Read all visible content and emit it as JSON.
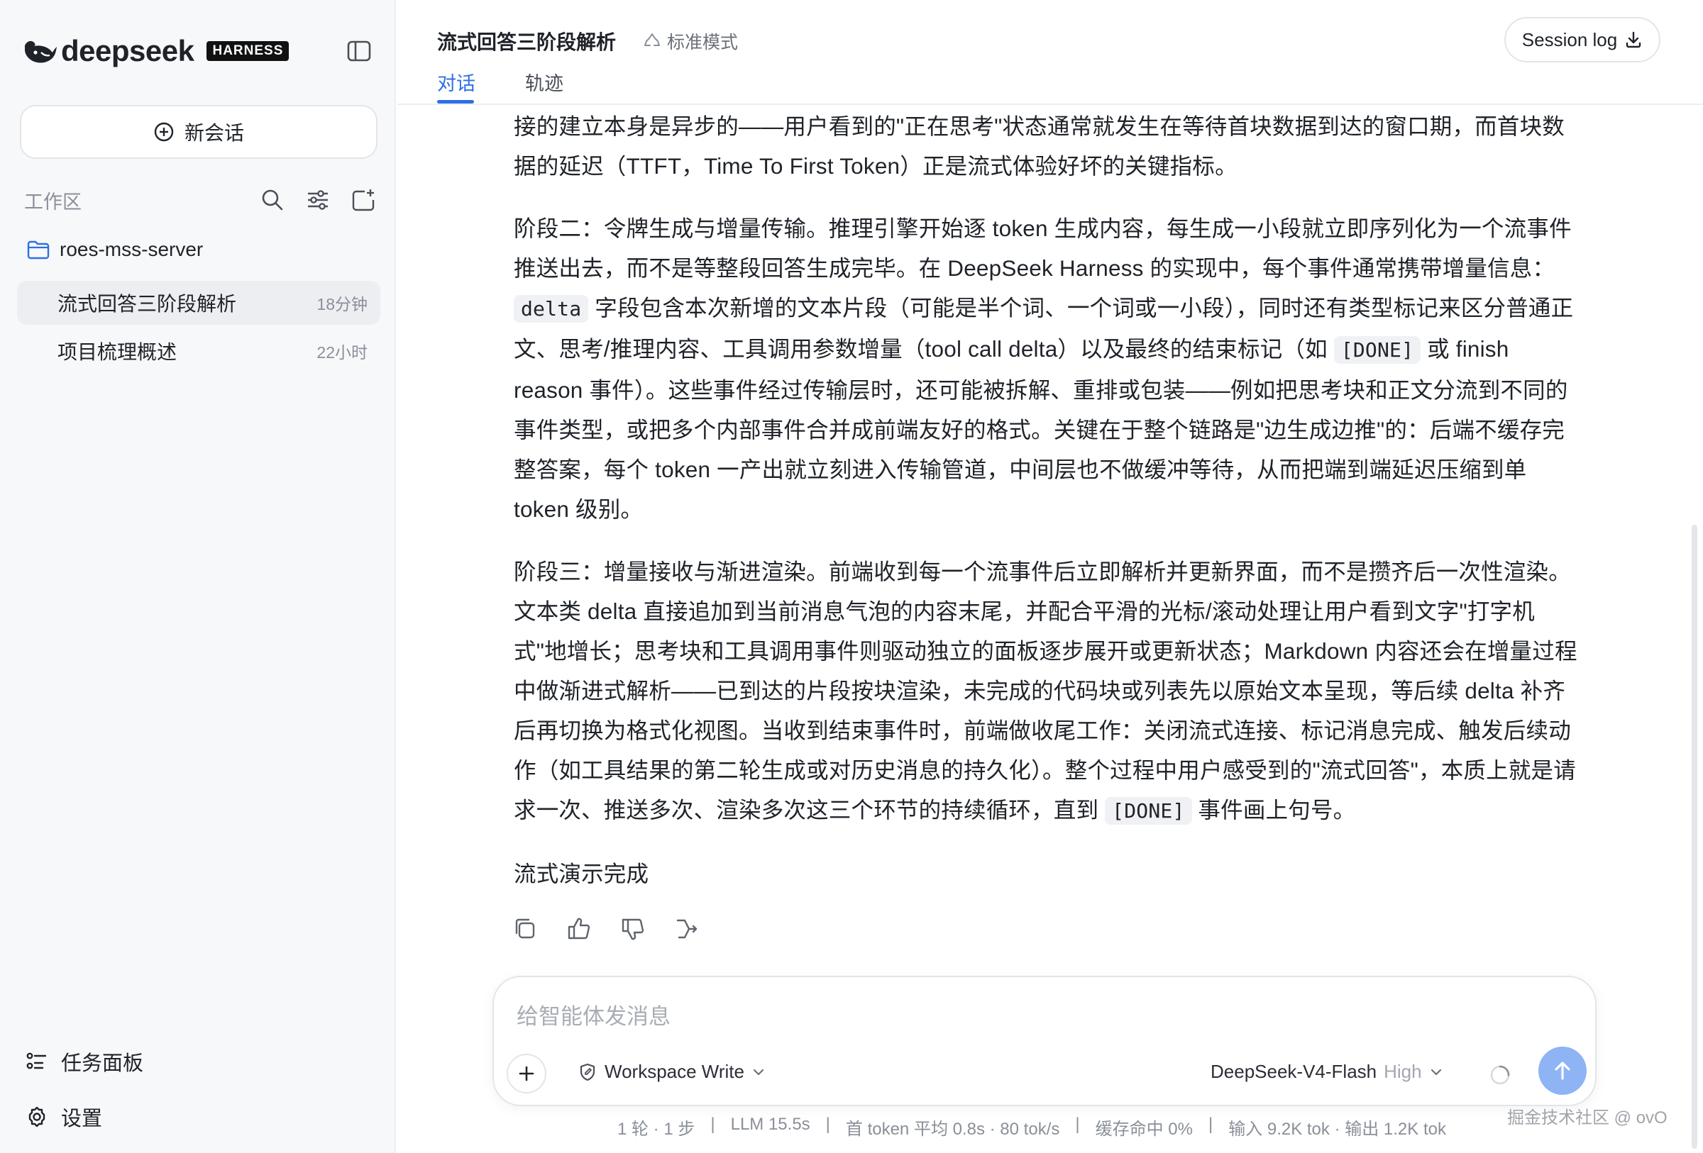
{
  "sidebar": {
    "brand_name": "deepseek",
    "brand_badge": "HARNESS",
    "new_chat_label": "新会话",
    "workspace_title": "工作区",
    "project_name": "roes-mss-server",
    "chats": [
      {
        "label": "流式回答三阶段解析",
        "time": "18分钟",
        "active": true
      },
      {
        "label": "项目梳理概述",
        "time": "22小时",
        "active": false
      }
    ],
    "task_board_label": "任务面板",
    "settings_label": "设置"
  },
  "header": {
    "title": "流式回答三阶段解析",
    "mode_label": "标准模式",
    "tabs": [
      {
        "label": "对话",
        "active": true
      },
      {
        "label": "轨迹",
        "active": false
      }
    ],
    "session_log_label": "Session log"
  },
  "message": {
    "p1": "接的建立本身是异步的——用户看到的\"正在思考\"状态通常就发生在等待首块数据到达的窗口期，而首块数据的延迟（TTFT，Time To First Token）正是流式体验好坏的关键指标。",
    "p2a": "阶段二：令牌生成与增量传输。推理引擎开始逐 token 生成内容，每生成一小段就立即序列化为一个流事件推送出去，而不是等整段回答生成完毕。在 DeepSeek Harness 的实现中，每个事件通常携带增量信息：",
    "p2_code1": "delta",
    "p2b": " 字段包含本次新增的文本片段（可能是半个词、一个词或一小段），同时还有类型标记来区分普通正文、思考/推理内容、工具调用参数增量（tool call delta）以及最终的结束标记（如 ",
    "p2_code2": "[DONE]",
    "p2c": " 或 finish reason 事件）。这些事件经过传输层时，还可能被拆解、重排或包装——例如把思考块和正文分流到不同的事件类型，或把多个内部事件合并成前端友好的格式。关键在于整个链路是\"边生成边推\"的：后端不缓存完整答案，每个 token 一产出就立刻进入传输管道，中间层也不做缓冲等待，从而把端到端延迟压缩到单 token 级别。",
    "p3a": "阶段三：增量接收与渐进渲染。前端收到每一个流事件后立即解析并更新界面，而不是攒齐后一次性渲染。文本类 delta 直接追加到当前消息气泡的内容末尾，并配合平滑的光标/滚动处理让用户看到文字\"打字机式\"地增长；思考块和工具调用事件则驱动独立的面板逐步展开或更新状态；Markdown 内容还会在增量过程中做渐进式解析——已到达的片段按块渲染，未完成的代码块或列表先以原始文本呈现，等后续 delta 补齐后再切换为格式化视图。当收到结束事件时，前端做收尾工作：关闭流式连接、标记消息完成、触发后续动作（如工具结果的第二轮生成或对历史消息的持久化）。整个过程中用户感受到的\"流式回答\"，本质上就是请求一次、推送多次、渲染多次这三个环节的持续循环，直到 ",
    "p3_code": "[DONE]",
    "p3b": " 事件画上句号。",
    "p4": "流式演示完成"
  },
  "composer": {
    "placeholder": "给智能体发消息",
    "permission_label": "Workspace Write",
    "model_label": "DeepSeek-V4-Flash",
    "effort_label": "High"
  },
  "stats": {
    "turns": "1 轮 · 1 步",
    "llm": "LLM 15.5s",
    "first_token": "首 token 平均 0.8s · 80 tok/s",
    "cache": "缓存命中 0%",
    "io": "输入 9.2K tok · 输出 1.2K tok",
    "sep": "|"
  },
  "watermark": "掘金技术社区 @ ovO",
  "colors": {
    "accent": "#2f6fe4",
    "send_button": "#8eb4f5",
    "sidebar_bg": "#f7f8fa"
  }
}
